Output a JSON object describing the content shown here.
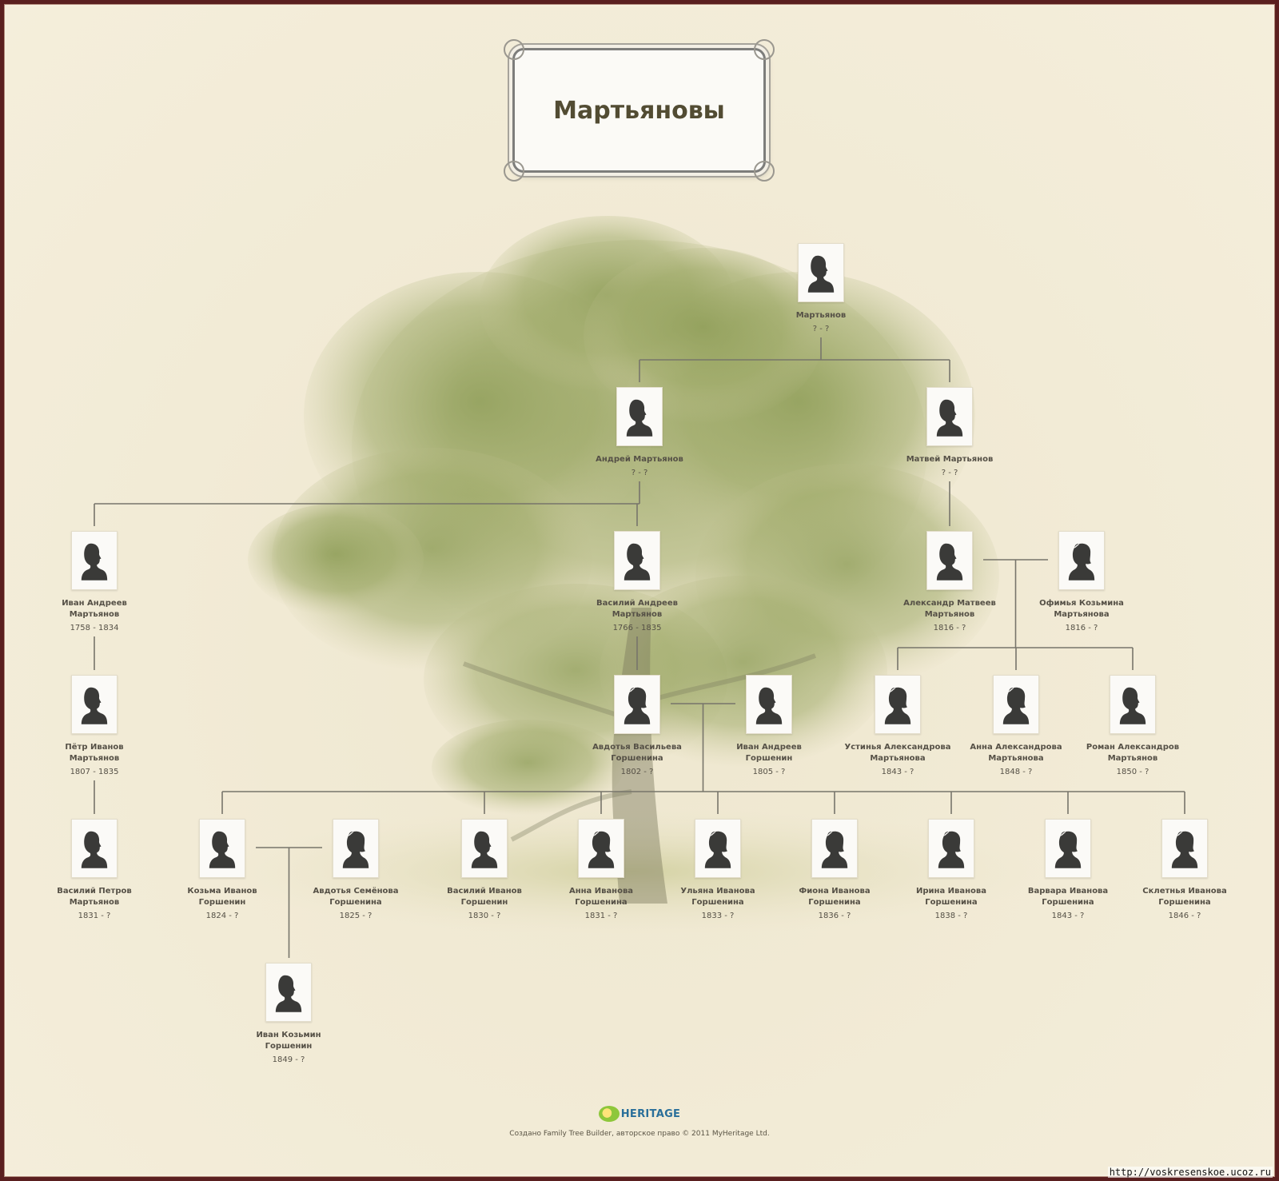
{
  "title": "Мартьяновы",
  "colors": {
    "frame": "#5a1f1f",
    "background": "#efe6cf",
    "connector": "#77756b",
    "silhouette": "#3a3a38",
    "text": "#555046"
  },
  "people": [
    {
      "id": "p0",
      "name_lines": [
        "Мартьянов"
      ],
      "dates": "? - ?",
      "gender": "male"
    },
    {
      "id": "p1",
      "name_lines": [
        "Андрей Мартьянов"
      ],
      "dates": "? - ?",
      "gender": "male"
    },
    {
      "id": "p2",
      "name_lines": [
        "Матвей Мартьянов"
      ],
      "dates": "? - ?",
      "gender": "male"
    },
    {
      "id": "p3",
      "name_lines": [
        "Иван Андреев",
        "Мартьянов"
      ],
      "dates": "1758 - 1834",
      "gender": "male"
    },
    {
      "id": "p4",
      "name_lines": [
        "Василий Андреев",
        "Мартьянов"
      ],
      "dates": "1766 - 1835",
      "gender": "male"
    },
    {
      "id": "p5",
      "name_lines": [
        "Александр Матвеев",
        "Мартьянов"
      ],
      "dates": "1816 - ?",
      "gender": "male"
    },
    {
      "id": "p6",
      "name_lines": [
        "Офимья Козьмина",
        "Мартьянова"
      ],
      "dates": "1816 - ?",
      "gender": "female"
    },
    {
      "id": "p7",
      "name_lines": [
        "Пётр Иванов",
        "Мартьянов"
      ],
      "dates": "1807 - 1835",
      "gender": "male"
    },
    {
      "id": "p8",
      "name_lines": [
        "Авдотья Васильева",
        "Горшенина"
      ],
      "dates": "1802 - ?",
      "gender": "female"
    },
    {
      "id": "p9",
      "name_lines": [
        "Иван Андреев",
        "Горшенин"
      ],
      "dates": "1805 - ?",
      "gender": "male"
    },
    {
      "id": "p10",
      "name_lines": [
        "Устинья Александрова",
        "Мартьянова"
      ],
      "dates": "1843 - ?",
      "gender": "female"
    },
    {
      "id": "p11",
      "name_lines": [
        "Анна Александрова",
        "Мартьянова"
      ],
      "dates": "1848 - ?",
      "gender": "female"
    },
    {
      "id": "p12",
      "name_lines": [
        "Роман Александров",
        "Мартьянов"
      ],
      "dates": "1850 - ?",
      "gender": "male"
    },
    {
      "id": "p13",
      "name_lines": [
        "Василий Петров",
        "Мартьянов"
      ],
      "dates": "1831 - ?",
      "gender": "male"
    },
    {
      "id": "p14",
      "name_lines": [
        "Козьма Иванов",
        "Горшенин"
      ],
      "dates": "1824 - ?",
      "gender": "male"
    },
    {
      "id": "p15",
      "name_lines": [
        "Авдотья Семёнова",
        "Горшенина"
      ],
      "dates": "1825 - ?",
      "gender": "female"
    },
    {
      "id": "p16",
      "name_lines": [
        "Василий Иванов",
        "Горшенин"
      ],
      "dates": "1830 - ?",
      "gender": "male"
    },
    {
      "id": "p17",
      "name_lines": [
        "Анна Иванова",
        "Горшенина"
      ],
      "dates": "1831 - ?",
      "gender": "female"
    },
    {
      "id": "p18",
      "name_lines": [
        "Ульяна Иванова",
        "Горшенина"
      ],
      "dates": "1833 - ?",
      "gender": "female"
    },
    {
      "id": "p19",
      "name_lines": [
        "Фиона Иванова",
        "Горшенина"
      ],
      "dates": "1836 - ?",
      "gender": "female"
    },
    {
      "id": "p20",
      "name_lines": [
        "Ирина Иванова",
        "Горшенина"
      ],
      "dates": "1838 - ?",
      "gender": "female"
    },
    {
      "id": "p21",
      "name_lines": [
        "Варвара Иванова",
        "Горшенина"
      ],
      "dates": "1843 - ?",
      "gender": "female"
    },
    {
      "id": "p22",
      "name_lines": [
        "Склетнья Иванова",
        "Горшенина"
      ],
      "dates": "1846 - ?",
      "gender": "female"
    },
    {
      "id": "p23",
      "name_lines": [
        "Иван Козьмин",
        "Горшенин"
      ],
      "dates": "1849 - ?",
      "gender": "male"
    }
  ],
  "couples": [
    {
      "partners": [
        "p5",
        "p6"
      ]
    },
    {
      "partners": [
        "p8",
        "p9"
      ]
    },
    {
      "partners": [
        "p14",
        "p15"
      ]
    }
  ],
  "families": [
    {
      "parents": [
        "p0"
      ],
      "children": [
        "p1",
        "p2"
      ]
    },
    {
      "parents": [
        "p1"
      ],
      "children": [
        "p3",
        "p4"
      ]
    },
    {
      "parents": [
        "p2"
      ],
      "children": [
        "p5"
      ]
    },
    {
      "parents": [
        "p3"
      ],
      "children": [
        "p7"
      ]
    },
    {
      "parents": [
        "p4"
      ],
      "children": [
        "p8"
      ]
    },
    {
      "parents": [
        "p5",
        "p6"
      ],
      "children": [
        "p10",
        "p11",
        "p12"
      ]
    },
    {
      "parents": [
        "p7"
      ],
      "children": [
        "p13"
      ]
    },
    {
      "parents": [
        "p8",
        "p9"
      ],
      "children": [
        "p14",
        "p16",
        "p17",
        "p18",
        "p19",
        "p20",
        "p21",
        "p22"
      ]
    },
    {
      "parents": [
        "p14",
        "p15"
      ],
      "children": [
        "p23"
      ]
    }
  ],
  "footer": {
    "logo_text": "HERITAGE",
    "logo_icon": "myheritage-logo-icon",
    "caption": "Создано Family Tree Builder, авторское право © 2011 MyHeritage Ltd."
  },
  "watermark": "http://voskresenskoe.ucoz.ru"
}
